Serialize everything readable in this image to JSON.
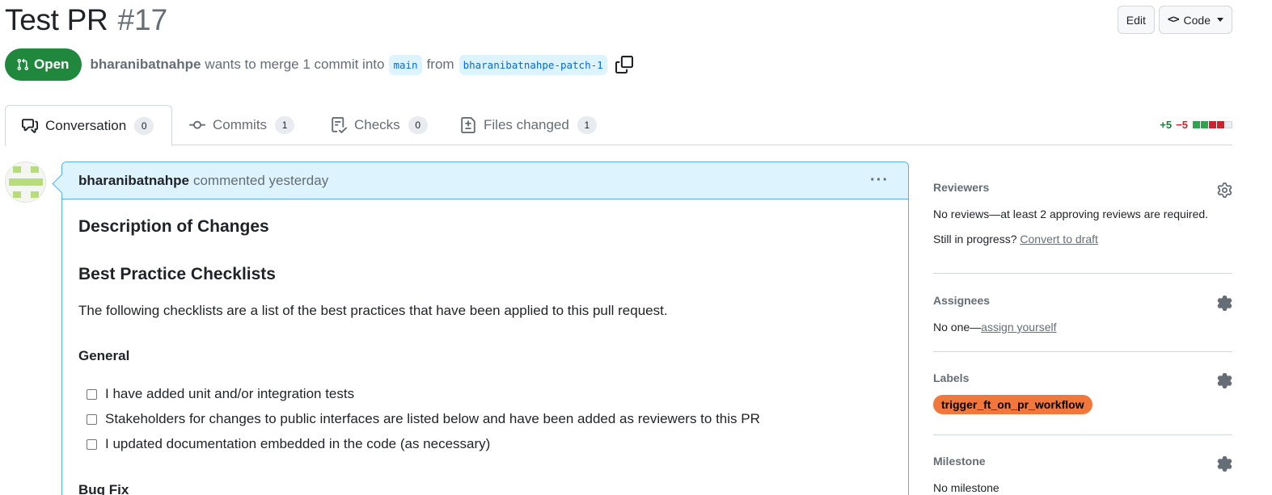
{
  "header": {
    "title": "Test PR",
    "number": "#17",
    "edit_label": "Edit",
    "code_label": "Code",
    "code_glyph": "<>"
  },
  "meta": {
    "state": "Open",
    "author": "bharanibatnahpe",
    "action_text": "wants to merge 1 commit into",
    "base_branch": "main",
    "from_text": "from",
    "head_branch": "bharanibatnahpe-patch-1"
  },
  "tabs": [
    {
      "label": "Conversation",
      "count": "0",
      "icon": "comment-discussion-icon"
    },
    {
      "label": "Commits",
      "count": "1",
      "icon": "git-commit-icon"
    },
    {
      "label": "Checks",
      "count": "0",
      "icon": "checklist-icon"
    },
    {
      "label": "Files changed",
      "count": "1",
      "icon": "file-diff-icon"
    }
  ],
  "diffstat": {
    "additions": "+5",
    "deletions": "−5",
    "blocks": [
      "#2da44e",
      "#2da44e",
      "#cf222e",
      "#cf222e",
      "#eaeef2"
    ]
  },
  "comment": {
    "author": "bharanibatnahpe",
    "action": "commented yesterday",
    "heading1": "Description of Changes",
    "heading2": "Best Practice Checklists",
    "intro": "The following checklists are a list of the best practices that have been applied to this pull request.",
    "general_heading": "General",
    "tasks": [
      "I have added unit and/or integration tests",
      "Stakeholders for changes to public interfaces are listed below and have been added as reviewers to this PR",
      "I updated documentation embedded in the code (as necessary)"
    ],
    "bugfix_heading": "Bug Fix"
  },
  "sidebar": {
    "reviewers": {
      "title": "Reviewers",
      "text": "No reviews—at least 2 approving reviews are required.",
      "progress_text": "Still in progress?",
      "progress_link": "Convert to draft"
    },
    "assignees": {
      "title": "Assignees",
      "text": "No one—",
      "link": "assign yourself"
    },
    "labels": {
      "title": "Labels",
      "label": "trigger_ft_on_pr_workflow"
    },
    "milestone": {
      "title": "Milestone",
      "text": "No milestone"
    }
  },
  "colors": {
    "open_green": "#1f883d",
    "link_blue": "#0969da",
    "branch_bg": "#ddf4ff",
    "label_orange": "#f1773d"
  }
}
